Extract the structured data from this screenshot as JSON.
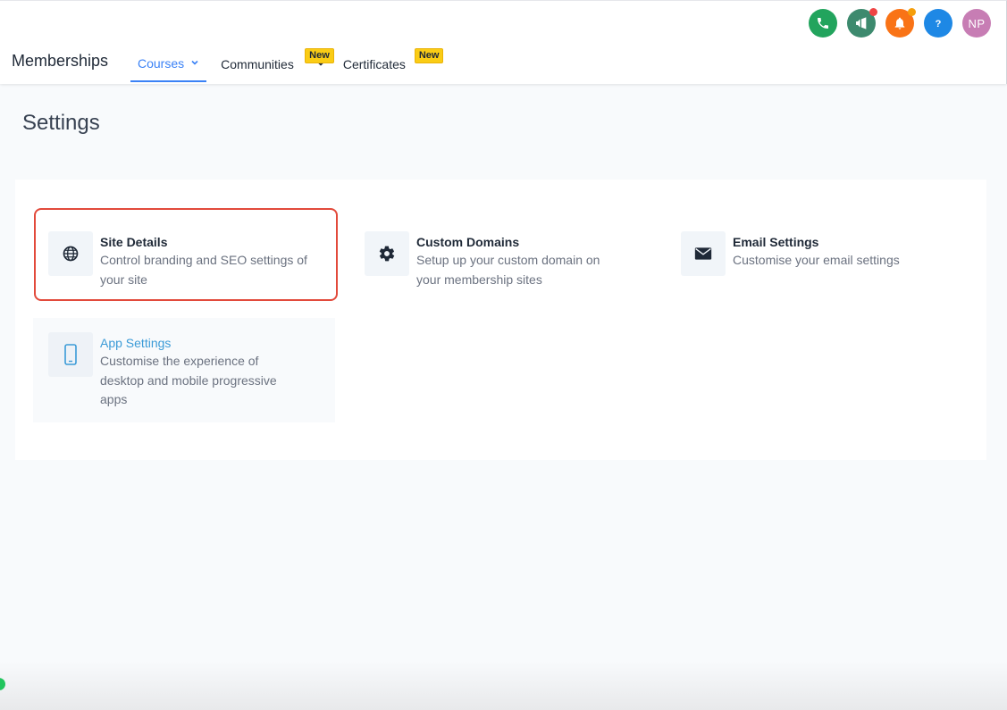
{
  "header": {
    "brand": "Memberships",
    "nav": {
      "courses": "Courses",
      "communities": "Communities",
      "certificates": "Certificates",
      "new_badge": "New"
    },
    "icons": [
      {
        "name": "phone-icon",
        "color": "#22a45d"
      },
      {
        "name": "megaphone-icon",
        "color": "#3d8a6e",
        "dot": "#ef4444"
      },
      {
        "name": "bell-icon",
        "color": "#f97316",
        "dot": "#f59e0b"
      },
      {
        "name": "help-icon",
        "color": "#1e88e5"
      }
    ],
    "avatar": {
      "initials": "NP",
      "color": "#c77db4"
    }
  },
  "page": {
    "title": "Settings"
  },
  "cards": {
    "site_details": {
      "icon": "globe-icon",
      "title": "Site Details",
      "desc": "Control branding and SEO settings of your site"
    },
    "custom_domains": {
      "icon": "gear-icon",
      "title": "Custom Domains",
      "desc": "Setup up your custom domain on your membership sites"
    },
    "email_settings": {
      "icon": "envelope-icon",
      "title": "Email Settings",
      "desc": "Customise your email settings"
    },
    "app_settings": {
      "icon": "mobile-phone-icon",
      "title": "App Settings",
      "desc": "Customise the experience of desktop and mobile progressive apps"
    }
  },
  "colors": {
    "accent": "#3b82f6",
    "highlight_border": "#e24a3b",
    "badge": "#facc15"
  }
}
